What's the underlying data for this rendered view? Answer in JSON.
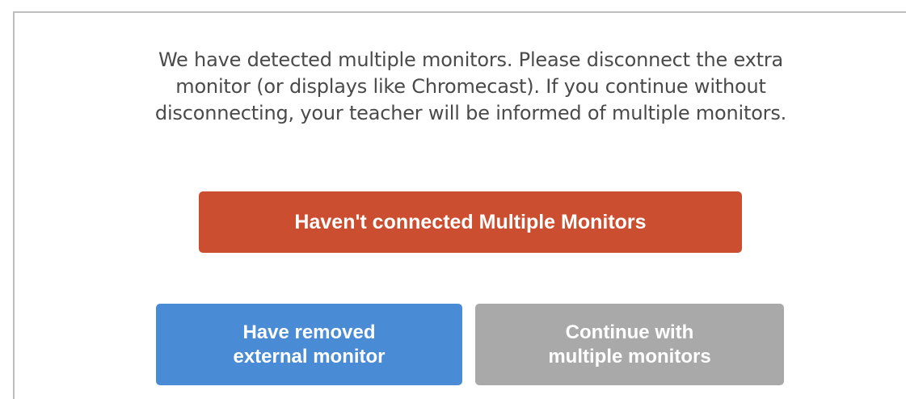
{
  "dialog": {
    "message": "We have detected multiple monitors. Please disconnect the extra monitor (or displays like Chromecast). If you continue without disconnecting, your teacher will be informed of multiple monitors.",
    "primary_button": "Haven't connected Multiple Monitors",
    "removed_button": "Have removed external monitor",
    "continue_button": "Continue with multiple monitors"
  },
  "colors": {
    "primary": "#cc4e30",
    "removed": "#4a8bd6",
    "continue": "#a9a9a9",
    "text": "#4a4a4a"
  }
}
